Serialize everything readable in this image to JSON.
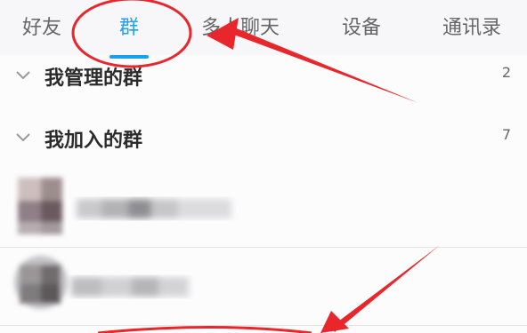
{
  "tabs": [
    {
      "label": "好友"
    },
    {
      "label": "群"
    },
    {
      "label": "多人聊天"
    },
    {
      "label": "设备"
    },
    {
      "label": "通讯录"
    }
  ],
  "groups": [
    {
      "title": "我管理的群",
      "count": "2"
    },
    {
      "title": "我加入的群",
      "count": "7"
    }
  ],
  "colors": {
    "accent": "#1fa3f0",
    "annotation": "#e8262b"
  }
}
